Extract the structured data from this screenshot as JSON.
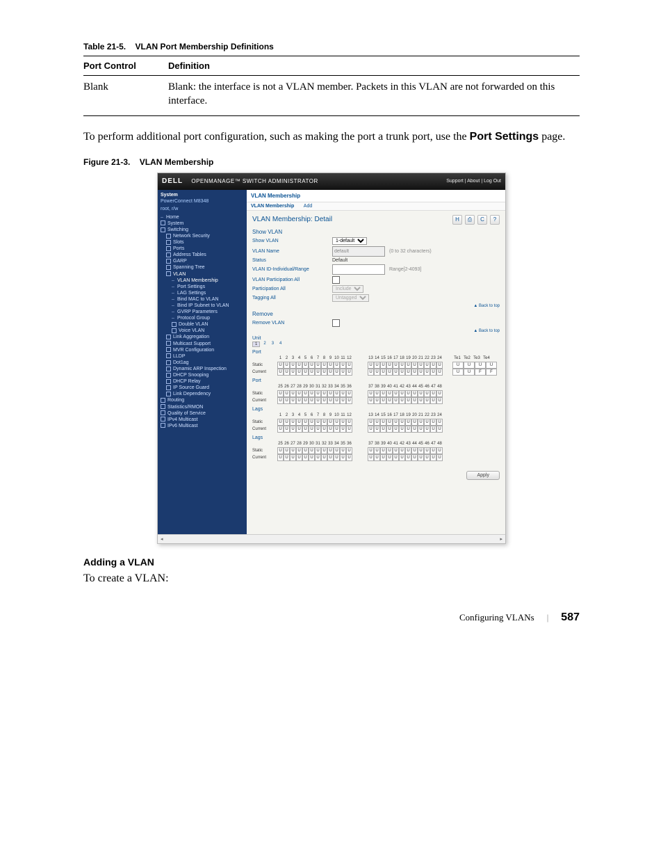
{
  "table": {
    "caption_prefix": "Table 21-5.",
    "caption_title": "VLAN Port Membership Definitions",
    "head_col1": "Port Control",
    "head_col2": "Definition",
    "row_col1": "Blank",
    "row_col2": "Blank: the interface is not a VLAN member. Packets in this VLAN are not forwarded on this interface."
  },
  "body_para_pre": "To perform additional port configuration, such as making the port a trunk port, use the ",
  "body_para_bold": "Port Settings",
  "body_para_post": " page.",
  "figure": {
    "caption_prefix": "Figure 21-3.",
    "caption_title": "VLAN Membership"
  },
  "shot": {
    "brand": "DELL",
    "app_title": "OPENMANAGE™ SWITCH ADMINISTRATOR",
    "top_links": "Support | About | Log Out",
    "nav_system": "System",
    "nav_device": "PowerConnect M8348",
    "nav_user": "root, r/w",
    "nav": {
      "home": "Home",
      "system": "System",
      "switching": "Switching",
      "network_security": "Network Security",
      "slots": "Slots",
      "ports": "Ports",
      "address_tables": "Address Tables",
      "garp": "GARP",
      "spanning_tree": "Spanning Tree",
      "vlan": "VLAN",
      "vlan_membership": "VLAN Membership",
      "port_settings": "Port Settings",
      "lag_settings": "LAG Settings",
      "bind_mac": "Bind MAC to VLAN",
      "bind_ip": "Bind IP Subnet to VLAN",
      "gvrp_params": "GVRP Parameters",
      "protocol_group": "Protocol Group",
      "double_vlan": "Double VLAN",
      "voice_vlan": "Voice VLAN",
      "link_agg": "Link Aggregation",
      "multicast_support": "Multicast Support",
      "mvr_config": "MVR Configuration",
      "lldp": "LLDP",
      "dot1ag": "Dot1ag",
      "dyn_arp": "Dynamic ARP Inspection",
      "dhcp_snoop": "DHCP Snooping",
      "dhcp_relay": "DHCP Relay",
      "ip_src_guard": "IP Source Guard",
      "link_dep": "Link Dependency",
      "routing": "Routing",
      "stats": "Statistics/RMON",
      "qos": "Quality of Service",
      "ipv4_mc": "IPv4 Multicast",
      "ipv6_mc": "IPv6 Multicast"
    },
    "crumb": "VLAN Membership",
    "tab_detail": "VLAN Membership",
    "tab_add": "Add",
    "page_title": "VLAN Membership: Detail",
    "icons": {
      "save": "H",
      "print": "⎙",
      "refresh": "C",
      "help": "?"
    },
    "sec_show": "Show VLAN",
    "row_show_vlan": "Show VLAN",
    "row_show_vlan_val": "1-default",
    "row_vlan_name": "VLAN Name",
    "row_vlan_name_val": "default",
    "row_vlan_name_hint": "(0 to 32 characters)",
    "row_status": "Status",
    "row_status_val": "Default",
    "row_vlan_id": "VLAN ID-Individual/Range",
    "row_vlan_id_hint": "Range[2-4093]",
    "row_part_all": "VLAN Participation All",
    "row_partic_all": "Participation All",
    "row_partic_all_val": "Include",
    "row_tag_all": "Tagging All",
    "row_tag_all_val": "Untagged",
    "back_to_top": "▲ Back to top",
    "sec_remove": "Remove",
    "row_remove": "Remove VLAN",
    "unit_label": "Unit",
    "unit_tabs": [
      "1",
      "2",
      "3",
      "4"
    ],
    "port_label": "Port",
    "lags_label": "Lags",
    "row_static": "Static",
    "row_current": "Current",
    "ports_a": [
      "1",
      "2",
      "3",
      "4",
      "5",
      "6",
      "7",
      "8",
      "9",
      "10",
      "11",
      "12"
    ],
    "ports_b": [
      "13",
      "14",
      "15",
      "16",
      "17",
      "18",
      "19",
      "20",
      "21",
      "22",
      "23",
      "24"
    ],
    "ports_c": [
      "25",
      "26",
      "27",
      "28",
      "29",
      "30",
      "31",
      "32",
      "33",
      "34",
      "35",
      "36"
    ],
    "ports_d": [
      "37",
      "38",
      "39",
      "40",
      "41",
      "42",
      "43",
      "44",
      "45",
      "46",
      "47",
      "48"
    ],
    "te_labels": [
      "Te1",
      "Te2",
      "Te3",
      "Te4"
    ],
    "cell_u": "U",
    "cell_f": "F",
    "apply": "Apply"
  },
  "subsec_title": "Adding a VLAN",
  "subsec_body": "To create a VLAN:",
  "footer_chapter": "Configuring VLANs",
  "footer_page": "587"
}
